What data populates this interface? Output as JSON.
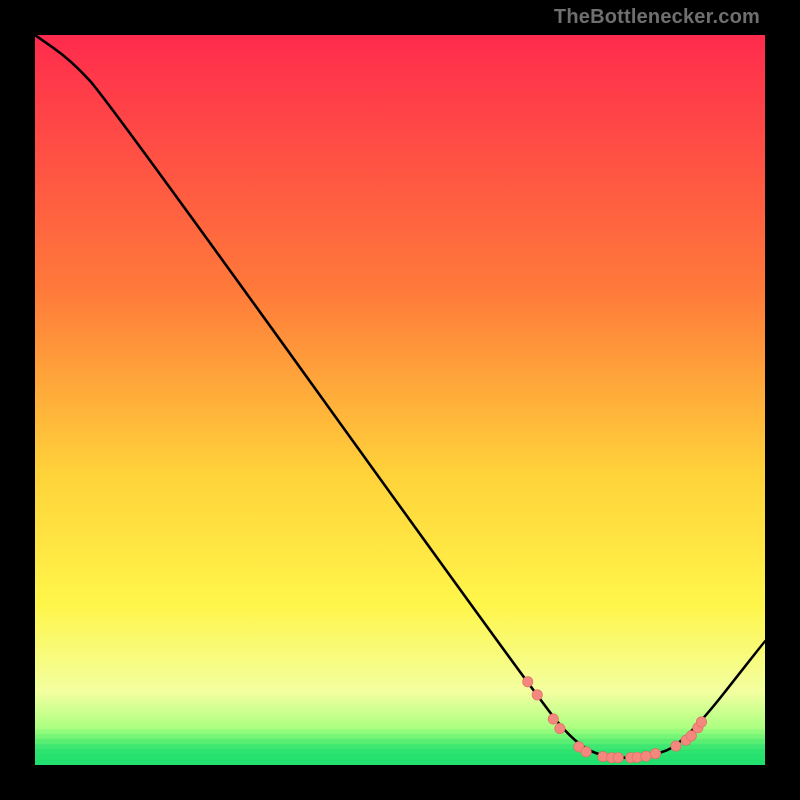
{
  "attribution": "TheBottlenecker.com",
  "colors": {
    "bg_black": "#000000",
    "curve": "#000000",
    "marker_fill": "#f4887e",
    "marker_stroke": "#de6b61",
    "grad_top": "#ff2b4d",
    "grad_mid1": "#ff7a3a",
    "grad_mid2": "#ffd23a",
    "grad_mid3": "#fff64a",
    "grad_mid4": "#f3ffa0",
    "grad_bottom1": "#9cff7a",
    "grad_bottom2": "#22e06e"
  },
  "chart_data": {
    "type": "line",
    "title": "",
    "xlabel": "",
    "ylabel": "",
    "xlim": [
      0,
      100
    ],
    "ylim": [
      0,
      100
    ],
    "curve": [
      {
        "x": 0,
        "y": 100
      },
      {
        "x": 5,
        "y": 96.5
      },
      {
        "x": 10,
        "y": 91
      },
      {
        "x": 69,
        "y": 9
      },
      {
        "x": 74,
        "y": 3
      },
      {
        "x": 78,
        "y": 1
      },
      {
        "x": 84,
        "y": 1
      },
      {
        "x": 89,
        "y": 3
      },
      {
        "x": 100,
        "y": 17
      }
    ],
    "markers": [
      {
        "x": 67.5,
        "y": 11.4
      },
      {
        "x": 68.8,
        "y": 9.6
      },
      {
        "x": 71.0,
        "y": 6.3
      },
      {
        "x": 71.9,
        "y": 5.0
      },
      {
        "x": 74.5,
        "y": 2.5
      },
      {
        "x": 75.5,
        "y": 1.8
      },
      {
        "x": 77.8,
        "y": 1.15
      },
      {
        "x": 79.0,
        "y": 1.0
      },
      {
        "x": 79.9,
        "y": 1.0
      },
      {
        "x": 81.6,
        "y": 1.0
      },
      {
        "x": 82.5,
        "y": 1.05
      },
      {
        "x": 83.7,
        "y": 1.2
      },
      {
        "x": 85.0,
        "y": 1.55
      },
      {
        "x": 87.8,
        "y": 2.6
      },
      {
        "x": 89.2,
        "y": 3.4
      },
      {
        "x": 89.9,
        "y": 4.0
      },
      {
        "x": 90.8,
        "y": 5.1
      },
      {
        "x": 91.3,
        "y": 5.9
      }
    ],
    "green_bands": [
      {
        "y": 0.0,
        "alpha": 1.0
      },
      {
        "y": 0.7,
        "alpha": 0.9
      },
      {
        "y": 1.4,
        "alpha": 0.78
      },
      {
        "y": 2.1,
        "alpha": 0.6
      },
      {
        "y": 2.8,
        "alpha": 0.42
      },
      {
        "y": 3.5,
        "alpha": 0.28
      },
      {
        "y": 4.2,
        "alpha": 0.14
      }
    ]
  }
}
